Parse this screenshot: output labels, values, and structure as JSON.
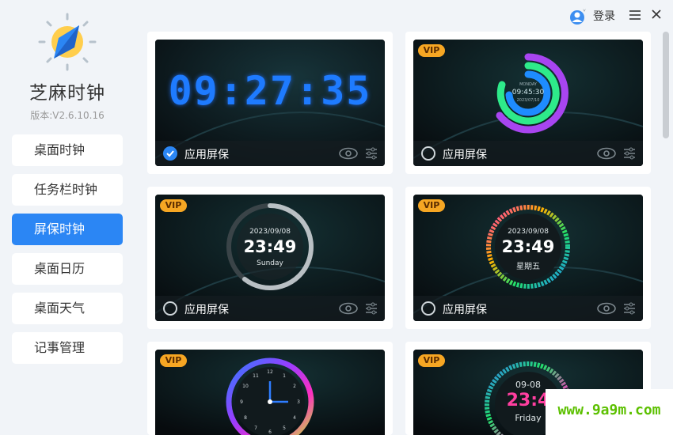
{
  "app": {
    "title": "芝麻时钟",
    "version": "版本:V2.6.10.16"
  },
  "nav": [
    {
      "label": "桌面时钟",
      "active": false
    },
    {
      "label": "任务栏时钟",
      "active": false
    },
    {
      "label": "屏保时钟",
      "active": true
    },
    {
      "label": "桌面日历",
      "active": false
    },
    {
      "label": "桌面天气",
      "active": false
    },
    {
      "label": "记事管理",
      "active": false
    }
  ],
  "topbar": {
    "login": "登录"
  },
  "cards": [
    {
      "vip": false,
      "checked": true,
      "apply": "应用屏保",
      "clock_time": "09:27:35"
    },
    {
      "vip": true,
      "vip_label": "VIP",
      "checked": false,
      "apply": "应用屏保",
      "clock_date": "MONDAY",
      "clock_time": "09:45:30",
      "clock_sub": "2023/07/10"
    },
    {
      "vip": true,
      "vip_label": "VIP",
      "checked": false,
      "apply": "应用屏保",
      "clock_date": "2023/09/08",
      "clock_time": "23:49",
      "clock_sub": "Sunday"
    },
    {
      "vip": true,
      "vip_label": "VIP",
      "checked": false,
      "apply": "应用屏保",
      "clock_date": "2023/09/08",
      "clock_time": "23:49",
      "clock_sub": "星期五"
    },
    {
      "vip": true,
      "vip_label": "VIP",
      "checked": false
    },
    {
      "vip": true,
      "vip_label": "VIP",
      "checked": false,
      "clock_date": "09-08",
      "clock_time": "23:4",
      "clock_sub": "Friday"
    }
  ],
  "watermark": "www.9a9m.com",
  "colors": {
    "accent": "#2b86f4",
    "vip": "#f6a623",
    "digital": "#1e7bff"
  }
}
